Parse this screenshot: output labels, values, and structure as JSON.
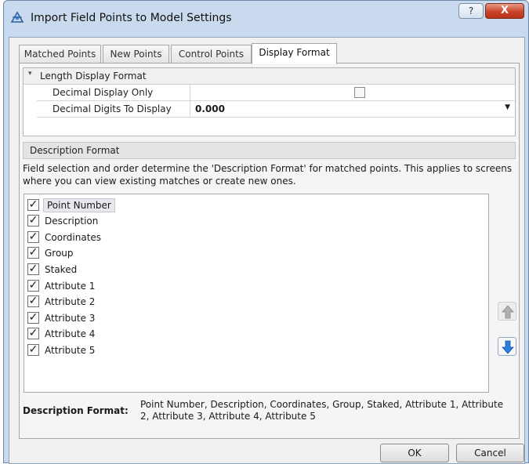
{
  "window": {
    "title": "Import Field Points to Model Settings",
    "help_glyph": "?",
    "close_glyph": "X"
  },
  "tabs": [
    {
      "label": "Matched Points",
      "active": false
    },
    {
      "label": "New Points",
      "active": false
    },
    {
      "label": "Control Points",
      "active": false
    },
    {
      "label": "Display Format",
      "active": true
    }
  ],
  "length_display_format": {
    "category_label": "Length Display Format",
    "collapse_glyph": "▾",
    "properties": [
      {
        "name": "Decimal Display Only",
        "type": "checkbox",
        "checked": false
      },
      {
        "name": "Decimal Digits To Display",
        "type": "dropdown",
        "value": "0.000"
      }
    ]
  },
  "description_format": {
    "header": "Description Format",
    "description": "Field selection and order determine the 'Description Format' for matched points. This applies to screens where you can view existing matches or create new ones.",
    "fields": [
      {
        "label": "Point Number",
        "checked": true,
        "selected": true
      },
      {
        "label": "Description",
        "checked": true,
        "selected": false
      },
      {
        "label": "Coordinates",
        "checked": true,
        "selected": false
      },
      {
        "label": "Group",
        "checked": true,
        "selected": false
      },
      {
        "label": "Staked",
        "checked": true,
        "selected": false
      },
      {
        "label": "Attribute 1",
        "checked": true,
        "selected": false
      },
      {
        "label": "Attribute 2",
        "checked": true,
        "selected": false
      },
      {
        "label": "Attribute 3",
        "checked": true,
        "selected": false
      },
      {
        "label": "Attribute 4",
        "checked": true,
        "selected": false
      },
      {
        "label": "Attribute 5",
        "checked": true,
        "selected": false
      }
    ],
    "summary_label": "Description Format:",
    "summary_value": "Point Number, Description, Coordinates, Group, Staked, Attribute 1, Attribute 2, Attribute 3, Attribute 4, Attribute 5",
    "move_up_enabled": false,
    "move_down_enabled": true
  },
  "buttons": {
    "ok": "OK",
    "cancel": "Cancel"
  },
  "colors": {
    "window_frame": "#c9d9ee",
    "close_button": "#c8442a",
    "arrow_down_blue": "#1e6fd0",
    "arrow_up_disabled": "#a8a8a8"
  }
}
